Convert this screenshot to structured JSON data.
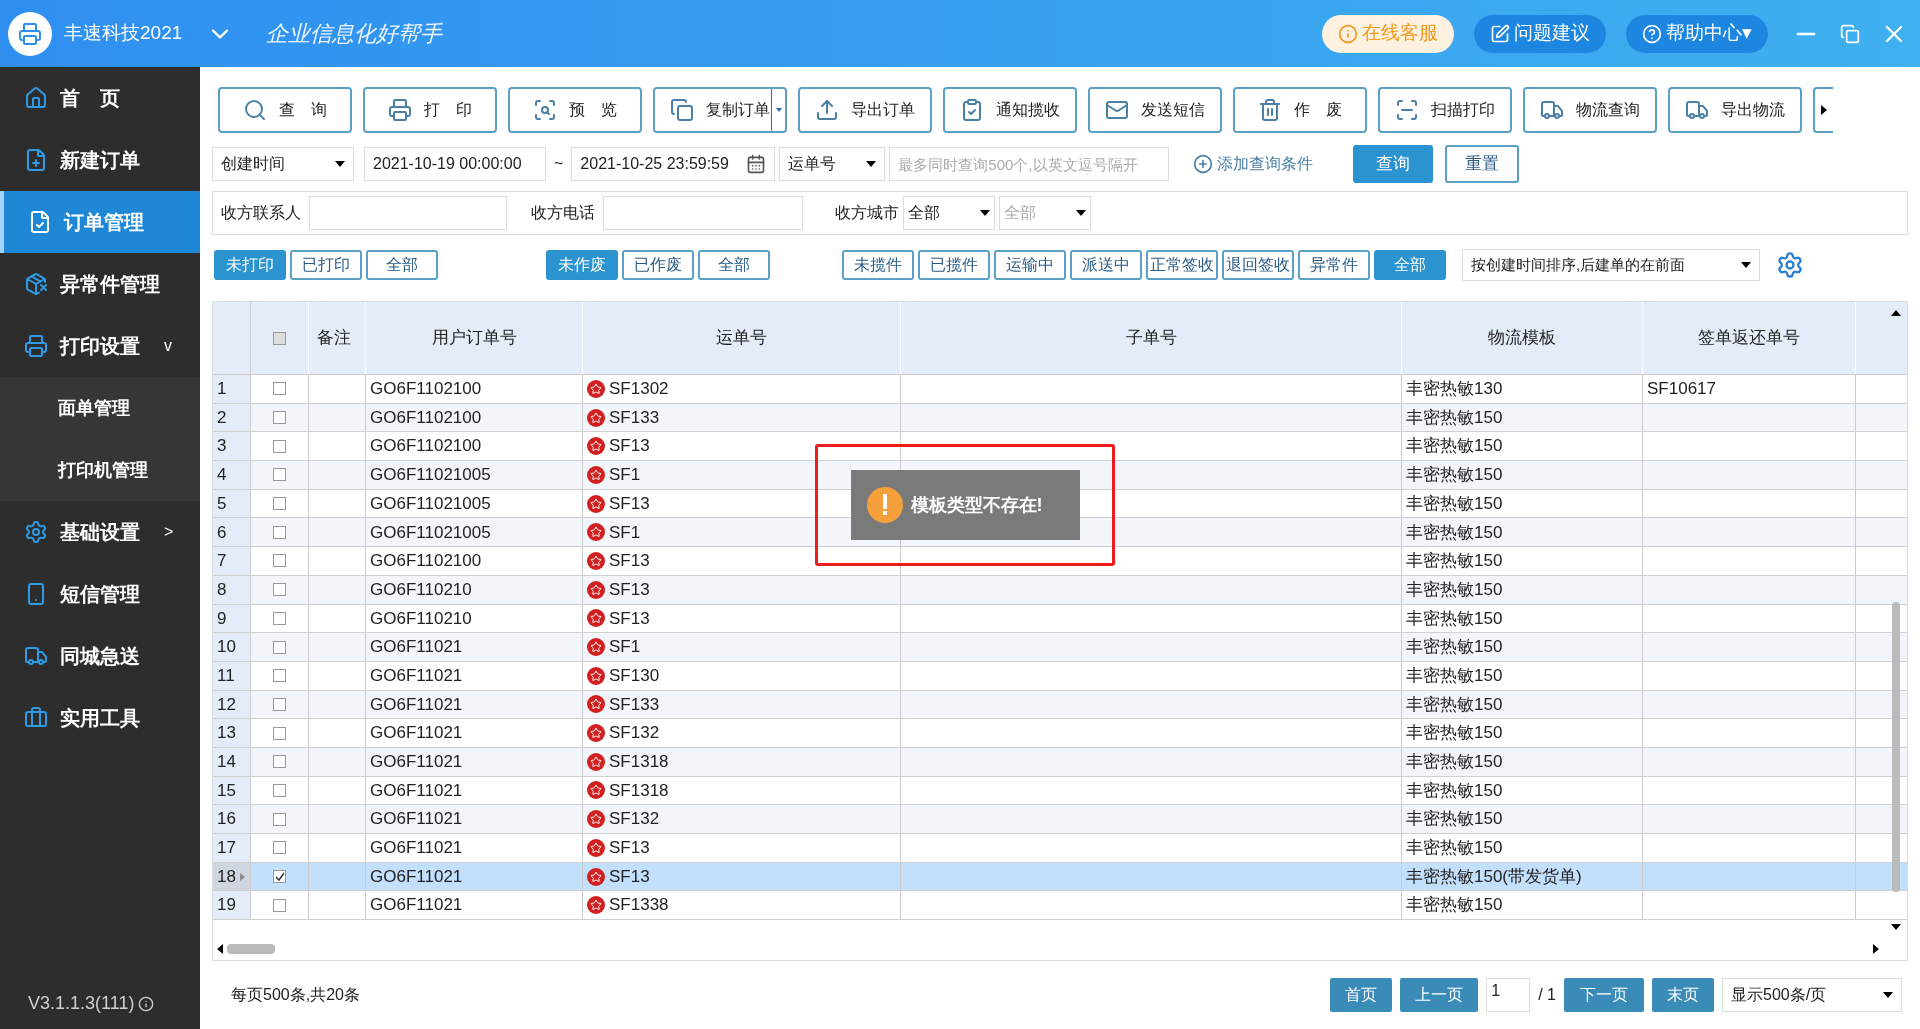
{
  "app": {
    "name": "丰速科技2021",
    "slogan": "企业信息化好帮手",
    "version": "V3.1.1.3(111)"
  },
  "header_buttons": [
    {
      "kind": "service",
      "label": "在线客服"
    },
    {
      "kind": "feedback",
      "label": "问题建议"
    },
    {
      "kind": "help",
      "label": "帮助中心▾"
    }
  ],
  "sidebar": {
    "items": [
      {
        "label": "首　页",
        "selected": false
      },
      {
        "label": "新建订单",
        "selected": false
      },
      {
        "label": "订单管理",
        "selected": true
      },
      {
        "label": "异常件管理",
        "selected": false
      },
      {
        "label": "打印设置",
        "arrow": "v",
        "children": [
          {
            "label": "面单管理"
          },
          {
            "label": "打印机管理"
          }
        ]
      },
      {
        "label": "基础设置",
        "arrow": ">"
      },
      {
        "label": "短信管理",
        "selected": false
      },
      {
        "label": "同城急送",
        "selected": false
      },
      {
        "label": "实用工具",
        "selected": false
      }
    ]
  },
  "toolbar": [
    {
      "label": "查　询"
    },
    {
      "label": "打　印"
    },
    {
      "label": "预　览"
    },
    {
      "label": "复制订单",
      "dropdown": true
    },
    {
      "label": "导出订单"
    },
    {
      "label": "通知揽收"
    },
    {
      "label": "发送短信"
    },
    {
      "label": "作　废"
    },
    {
      "label": "扫描打印"
    },
    {
      "label": "物流查询"
    },
    {
      "label": "导出物流"
    }
  ],
  "query": {
    "time_field": "创建时间",
    "start": "2021-10-19 00:00:00",
    "separator": "~",
    "end": "2021-10-25 23:59:59",
    "number_field": "运单号",
    "number_placeholder": "最多同时查询500个,以英文逗号隔开",
    "add_condition": "添加查询条件",
    "search": "查询",
    "reset": "重置"
  },
  "filters": {
    "contact_label": "收方联系人",
    "phone_label": "收方电话",
    "city_label": "收方城市",
    "city": "全部",
    "district": "全部"
  },
  "status_groups": [
    [
      {
        "label": "未打印",
        "selected": true
      },
      {
        "label": "已打印",
        "selected": false
      },
      {
        "label": "全部",
        "selected": false
      }
    ],
    [
      {
        "label": "未作废",
        "selected": true
      },
      {
        "label": "已作废",
        "selected": false
      },
      {
        "label": "全部",
        "selected": false
      }
    ],
    [
      {
        "label": "未揽件",
        "selected": false
      },
      {
        "label": "已揽件",
        "selected": false
      },
      {
        "label": "运输中",
        "selected": false
      },
      {
        "label": "派送中",
        "selected": false
      },
      {
        "label": "正常签收",
        "selected": false
      },
      {
        "label": "退回签收",
        "selected": false
      },
      {
        "label": "异常件",
        "selected": false
      },
      {
        "label": "全部",
        "selected": true
      }
    ]
  ],
  "sort": "按创建时间排序,后建单的在前面",
  "table": {
    "all_checked": false,
    "columns": [
      "备注",
      "用户订单号",
      "运单号",
      "子单号",
      "物流模板",
      "签单返还单号"
    ],
    "rows": [
      {
        "n": "1",
        "checked": false,
        "selected": false,
        "order": "GO6F1102100",
        "waybill": "SF1302",
        "template": "丰密热敏130",
        "return_no": "SF10617"
      },
      {
        "n": "2",
        "checked": false,
        "selected": false,
        "order": "GO6F1102100",
        "waybill": "SF133",
        "template": "丰密热敏150"
      },
      {
        "n": "3",
        "checked": false,
        "selected": false,
        "order": "GO6F1102100",
        "waybill": "SF13",
        "template": "丰密热敏150"
      },
      {
        "n": "4",
        "checked": false,
        "selected": false,
        "order": "GO6F11021005",
        "waybill": "SF1",
        "template": "丰密热敏150"
      },
      {
        "n": "5",
        "checked": false,
        "selected": false,
        "order": "GO6F11021005",
        "waybill": "SF13",
        "template": "丰密热敏150"
      },
      {
        "n": "6",
        "checked": false,
        "selected": false,
        "order": "GO6F11021005",
        "waybill": "SF1",
        "template": "丰密热敏150"
      },
      {
        "n": "7",
        "checked": false,
        "selected": false,
        "order": "GO6F1102100",
        "waybill": "SF13",
        "template": "丰密热敏150"
      },
      {
        "n": "8",
        "checked": false,
        "selected": false,
        "order": "GO6F110210",
        "waybill": "SF13",
        "template": "丰密热敏150"
      },
      {
        "n": "9",
        "checked": false,
        "selected": false,
        "order": "GO6F110210",
        "waybill": "SF13",
        "template": "丰密热敏150"
      },
      {
        "n": "10",
        "checked": false,
        "selected": false,
        "order": "GO6F11021",
        "waybill": "SF1",
        "template": "丰密热敏150"
      },
      {
        "n": "11",
        "checked": false,
        "selected": false,
        "order": "GO6F11021",
        "waybill": "SF130",
        "template": "丰密热敏150"
      },
      {
        "n": "12",
        "checked": false,
        "selected": false,
        "order": "GO6F11021",
        "waybill": "SF133",
        "template": "丰密热敏150"
      },
      {
        "n": "13",
        "checked": false,
        "selected": false,
        "order": "GO6F11021",
        "waybill": "SF132",
        "template": "丰密热敏150"
      },
      {
        "n": "14",
        "checked": false,
        "selected": false,
        "order": "GO6F11021",
        "waybill": "SF1318",
        "template": "丰密热敏150"
      },
      {
        "n": "15",
        "checked": false,
        "selected": false,
        "order": "GO6F11021",
        "waybill": "SF1318",
        "template": "丰密热敏150"
      },
      {
        "n": "16",
        "checked": false,
        "selected": false,
        "order": "GO6F11021",
        "waybill": "SF132",
        "template": "丰密热敏150"
      },
      {
        "n": "17",
        "checked": false,
        "selected": false,
        "order": "GO6F11021",
        "waybill": "SF13",
        "template": "丰密热敏150"
      },
      {
        "n": "18",
        "checked": true,
        "selected": true,
        "order": "GO6F11021",
        "waybill": "SF13",
        "template": "丰密热敏150(带发货单)"
      },
      {
        "n": "19",
        "checked": false,
        "selected": false,
        "order": "GO6F11021",
        "waybill": "SF1338",
        "template": "丰密热敏150"
      }
    ]
  },
  "toast": {
    "message": "模板类型不存在!",
    "highlighted": true
  },
  "footer": {
    "summary": "每页500条,共20条",
    "first": "首页",
    "prev": "上一页",
    "page": "1",
    "total": "/ 1",
    "next": "下一页",
    "last": "末页",
    "page_size": "显示500条/页"
  }
}
